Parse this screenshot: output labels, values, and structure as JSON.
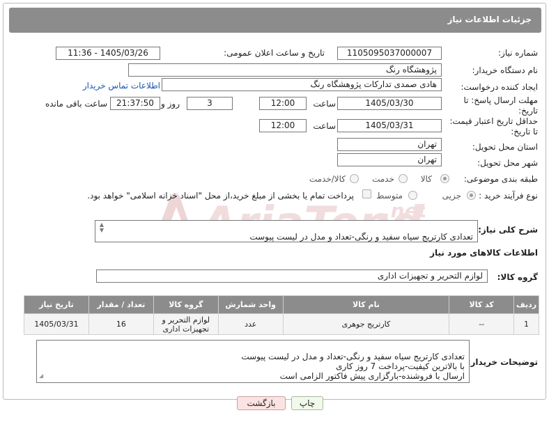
{
  "panel": {
    "title": "جزئیات اطلاعات نیاز"
  },
  "form": {
    "need_number": {
      "label": "شماره نیاز:",
      "value": "1105095037000007"
    },
    "announce_datetime": {
      "label": "تاریخ و ساعت اعلان عمومی:",
      "value": "1405/03/26 - 11:36"
    },
    "buyer_org": {
      "label": "نام دستگاه خریدار:",
      "value": "پژوهشگاه رنگ"
    },
    "requester": {
      "label": "ایجاد کننده درخواست:",
      "value": "هادی صمدی تدارکات پژوهشگاه رنگ",
      "contact_link": "اطلاعات تماس خریدار"
    },
    "reply_deadline": {
      "label_line1": "مهلت ارسال پاسخ: تا",
      "label_line2": "تاریخ:",
      "date": "1405/03/30",
      "time_label": "ساعت",
      "time": "12:00",
      "days": "3",
      "days_label": "روز و",
      "remaining_time": "21:37:50",
      "remaining_label": "ساعت باقی مانده"
    },
    "price_validity": {
      "label_line1": "حداقل تاریخ اعتبار قیمت:",
      "label_line2": "تا تاریخ:",
      "date": "1405/03/31",
      "time_label": "ساعت",
      "time": "12:00"
    },
    "province": {
      "label": "استان محل تحویل:",
      "value": "تهران"
    },
    "city": {
      "label": "شهر محل تحویل:",
      "value": "تهران"
    },
    "category": {
      "label": "طبقه بندی موضوعی:",
      "options": [
        "کالا",
        "خدمت",
        "کالا/خدمت"
      ],
      "selected": "کالا"
    },
    "purchase_type": {
      "label": "نوع فرآیند خرید :",
      "options": [
        "جزیی",
        "متوسط"
      ],
      "selected": "جزیی",
      "payment_note": "پرداخت تمام یا بخشی از مبلغ خرید،از محل \"اسناد خزانه اسلامی\" خواهد بود."
    }
  },
  "description": {
    "label": "شرح کلی نیاز:",
    "text": "تعدادی کارتریج سیاه سفید و رنگی-تعداد و مدل در لیست پیوست\nبا بالاترین کیفیت-پرداخت 7 روز کاری"
  },
  "goods_section": {
    "title": "اطلاعات کالاهای مورد نیاز",
    "group_label": "گروه کالا:",
    "group_value": "لوازم التحریر و تجهیزات اداری"
  },
  "table": {
    "headers": [
      "ردیف",
      "کد کالا",
      "نام کالا",
      "واحد شمارش",
      "گروه کالا",
      "تعداد / مقدار",
      "تاریخ نیاز"
    ],
    "rows": [
      {
        "row": "1",
        "code": "--",
        "name": "کارتریج جوهری",
        "unit": "عدد",
        "group": "لوازم التحریر و تجهیزات اداری",
        "quantity": "16",
        "date": "1405/03/31"
      }
    ]
  },
  "buyer_notes": {
    "label": "توضیحات خریدار:",
    "text": "تعدادی کارتریج سیاه سفید و رنگی-تعداد و مدل در لیست پیوست\nبا بالاترین کیفیت-پرداخت 7 روز کاری\nارسال با فروشنده-بارگزاری پیش فاکتور الزامی است"
  },
  "buttons": {
    "print": "چاپ",
    "back": "بازگشت"
  },
  "watermark": {
    "text": "AriaTender.net",
    "color": "#d9a0a0"
  }
}
